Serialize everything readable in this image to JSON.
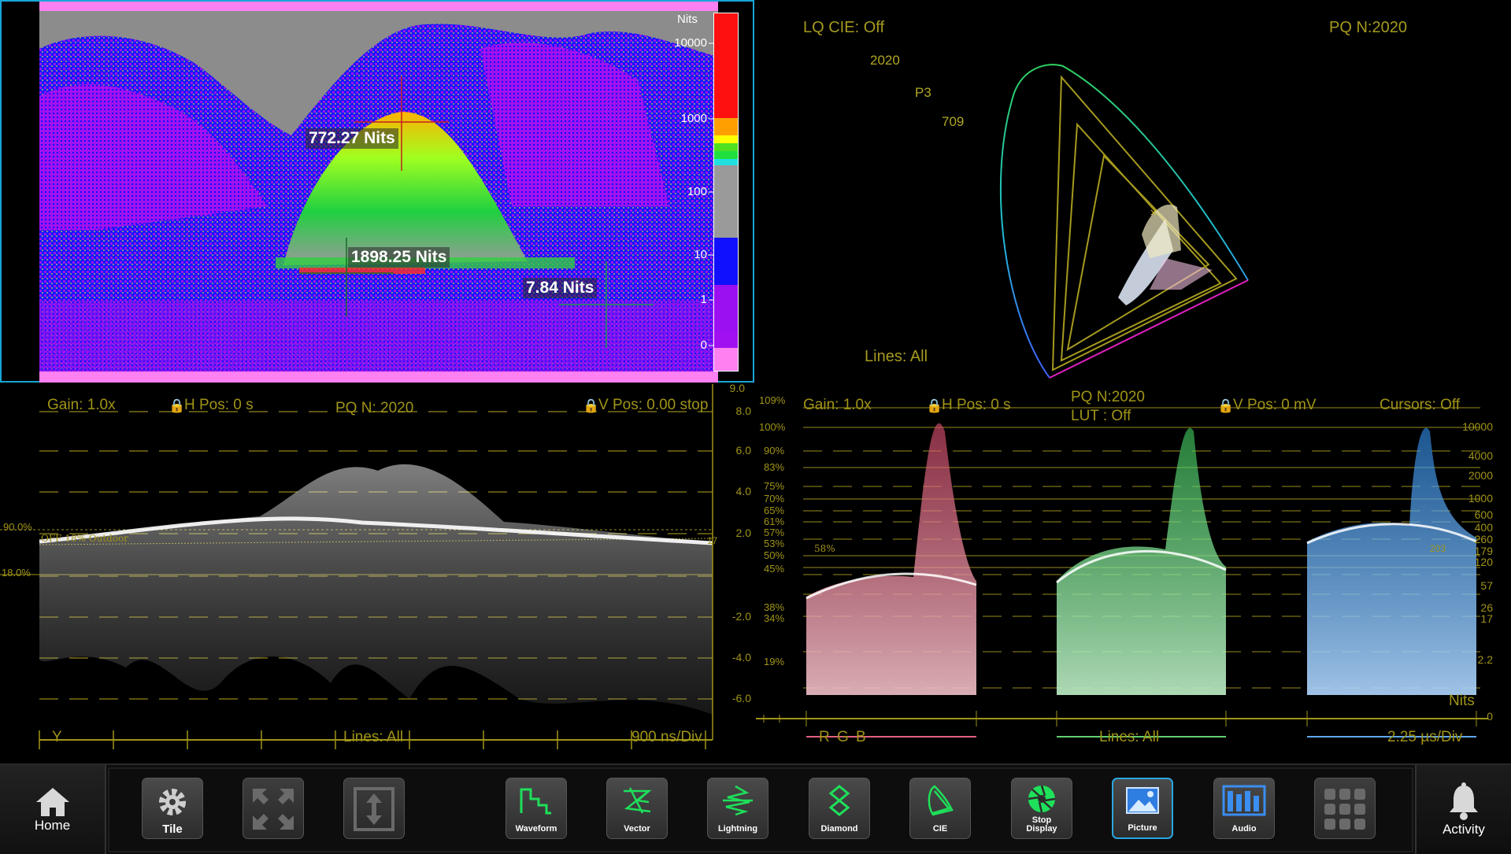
{
  "picture": {
    "scale_title": "Nits",
    "scale_ticks": [
      "10000",
      "1000",
      "100",
      "10",
      "1",
      "0"
    ],
    "readouts": [
      "772.27 Nits",
      "1898.25 Nits",
      "7.84 Nits"
    ]
  },
  "cie": {
    "lq_cie": "LQ CIE: Off",
    "pq": "PQ N:2020",
    "gamuts": [
      "2020",
      "P3",
      "709"
    ],
    "lines": "Lines: All"
  },
  "waveform": {
    "gain": "Gain: 1.0x",
    "h_pos": "H Pos: 0 s",
    "pq": "PQ N: 2020",
    "v_pos": "V Pos: 0.00 stop",
    "top_value": "9.0",
    "stops": [
      "8.0",
      "6.0",
      "4.0",
      "2.0",
      "-2.0",
      "-4.0",
      "-6.0"
    ],
    "left_marks": [
      "90.0%",
      "18.0%"
    ],
    "ref_label": "OFF 18% Outdoor",
    "ref_right": "17",
    "channel": "Y",
    "lines": "Lines: All",
    "timebase": "900 ns/Div"
  },
  "rgb_parade": {
    "gain": "Gain: 1.0x",
    "h_pos": "H Pos: 0 s",
    "pq": "PQ N:2020",
    "lut": "LUT : Off",
    "v_pos": "V Pos: 0 mV",
    "cursors": "Cursors: Off",
    "left_percent": [
      "109%",
      "100%",
      "90%",
      "83%",
      "75%",
      "70%",
      "65%",
      "61%",
      "57%",
      "53%",
      "50%",
      "45%",
      "38%",
      "34%",
      "19%"
    ],
    "right_nits": [
      "10000",
      "4000",
      "2000",
      "1000",
      "600",
      "400",
      "260",
      "179",
      "120",
      "57",
      "26",
      "17",
      "2.2",
      "0"
    ],
    "marker_58": "58%",
    "marker_203": "203",
    "nits_label": "Nits",
    "channels": "R G B",
    "lines": "Lines: All",
    "timebase": "2.25 µs/Div"
  },
  "toolbar": {
    "home": "Home",
    "tile": "Tile",
    "waveform": "Waveform",
    "vector": "Vector",
    "lightning": "Lightning",
    "diamond": "Diamond",
    "cie": "CIE",
    "stop_display": "Stop Display",
    "picture": "Picture",
    "audio": "Audio",
    "activity": "Activity"
  },
  "colors": {
    "accent": "#19a6d6",
    "graticule": "#a09418",
    "false_blue": "#1414ff",
    "false_magenta": "#9a10f0",
    "false_gray": "#8a8a8a"
  }
}
